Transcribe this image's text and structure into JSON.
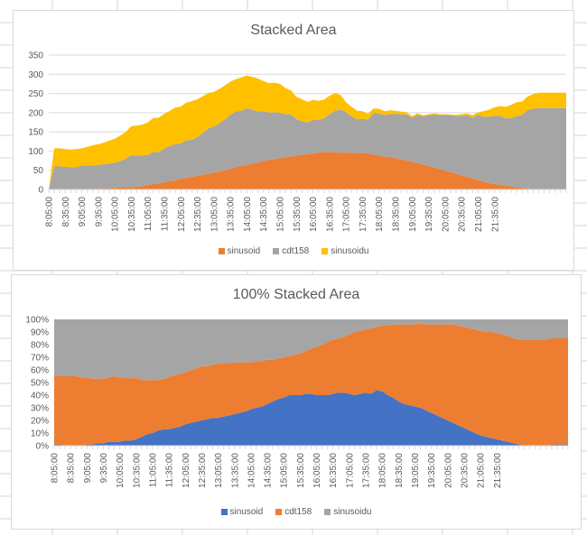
{
  "chart_data": [
    {
      "type": "area",
      "stacking": "normal",
      "title": "Stacked Area",
      "xlabel": "",
      "ylabel": "",
      "ylim": [
        0,
        350
      ],
      "yticks": [
        "0",
        "50",
        "100",
        "150",
        "200",
        "250",
        "300",
        "350"
      ],
      "grid": true,
      "legend": "bottom",
      "x_tick_labels": [
        "8:05:00",
        "8:35:00",
        "9:05:00",
        "9:35:00",
        "10:05:00",
        "10:35:00",
        "11:05:00",
        "11:35:00",
        "12:05:00",
        "12:35:00",
        "13:05:00",
        "13:35:00",
        "14:05:00",
        "14:35:00",
        "15:05:00",
        "15:35:00",
        "16:05:00",
        "16:35:00",
        "17:05:00",
        "17:35:00",
        "18:05:00",
        "18:35:00",
        "19:05:00",
        "19:35:00",
        "20:05:00",
        "20:35:00",
        "21:05:00",
        "21:35:00"
      ],
      "x_step_minutes": 10,
      "series": [
        {
          "name": "sinusoid",
          "color": "#ED7D31",
          "values": [
            0,
            0,
            0,
            0,
            0,
            0,
            0,
            0,
            0,
            1,
            2,
            3,
            4,
            5,
            6,
            6,
            7,
            9,
            12,
            14,
            16,
            19,
            22,
            24,
            28,
            30,
            33,
            36,
            38,
            41,
            44,
            47,
            50,
            54,
            58,
            62,
            64,
            67,
            70,
            74,
            77,
            79,
            82,
            84,
            86,
            88,
            90,
            92,
            94,
            96,
            97,
            98,
            97,
            96,
            96,
            96,
            95,
            95,
            94,
            91,
            88,
            86,
            84,
            82,
            78,
            75,
            72,
            69,
            65,
            61,
            57,
            53,
            49,
            45,
            41,
            37,
            33,
            29,
            25,
            21,
            17,
            14,
            12,
            10,
            8,
            6,
            4,
            2,
            0,
            0,
            0,
            0,
            0,
            0,
            0,
            0,
            0
          ]
        },
        {
          "name": "cdt158",
          "color": "#A5A5A5",
          "values": [
            0,
            60,
            60,
            59,
            58,
            58,
            62,
            63,
            63,
            63,
            64,
            64,
            66,
            69,
            74,
            83,
            81,
            80,
            78,
            84,
            81,
            88,
            91,
            94,
            92,
            98,
            97,
            101,
            109,
            118,
            120,
            125,
            133,
            141,
            145,
            143,
            148,
            140,
            134,
            130,
            123,
            122,
            118,
            112,
            110,
            95,
            88,
            82,
            87,
            85,
            88,
            98,
            108,
            112,
            105,
            94,
            88,
            89,
            88,
            108,
            110,
            108,
            112,
            115,
            118,
            120,
            115,
            125,
            125,
            132,
            138,
            141,
            145,
            148,
            150,
            155,
            160,
            158,
            170,
            168,
            173,
            178,
            180,
            175,
            178,
            185,
            190,
            205,
            210,
            212,
            212,
            212,
            212,
            212,
            212
          ]
        },
        {
          "name": "sinusoidu",
          "color": "#FFC000",
          "values": [
            0,
            47,
            47,
            46,
            46,
            47,
            45,
            48,
            52,
            54,
            56,
            60,
            62,
            66,
            70,
            76,
            78,
            80,
            85,
            88,
            90,
            90,
            92,
            95,
            96,
            98,
            100,
            98,
            96,
            92,
            90,
            90,
            88,
            86,
            84,
            87,
            85,
            86,
            85,
            78,
            77,
            77,
            75,
            68,
            62,
            58,
            57,
            54,
            52,
            50,
            49,
            48,
            46,
            38,
            26,
            25,
            22,
            20,
            15,
            12,
            12,
            10,
            10,
            8,
            7,
            6,
            4,
            4,
            3,
            3,
            3,
            2,
            2,
            2,
            3,
            4,
            5,
            6,
            6,
            15,
            18,
            22,
            25,
            30,
            34,
            36,
            35,
            35,
            38,
            40,
            40,
            40,
            40,
            40,
            40
          ]
        }
      ]
    },
    {
      "type": "area",
      "stacking": "percent",
      "title": "100% Stacked Area",
      "xlabel": "",
      "ylabel": "",
      "ylim": [
        0,
        100
      ],
      "yticks": [
        "0%",
        "10%",
        "20%",
        "30%",
        "40%",
        "50%",
        "60%",
        "70%",
        "80%",
        "90%",
        "100%"
      ],
      "grid": false,
      "legend": "bottom",
      "x_tick_labels": [
        "8:05:00",
        "8:35:00",
        "9:05:00",
        "9:35:00",
        "10:05:00",
        "10:35:00",
        "11:05:00",
        "11:35:00",
        "12:05:00",
        "12:35:00",
        "13:05:00",
        "13:35:00",
        "14:05:00",
        "14:35:00",
        "15:05:00",
        "15:35:00",
        "16:05:00",
        "16:35:00",
        "17:05:00",
        "17:35:00",
        "18:05:00",
        "18:35:00",
        "19:05:00",
        "19:35:00",
        "20:05:00",
        "20:35:00",
        "21:05:00",
        "21:35:00"
      ],
      "x_step_minutes": 10,
      "series": [
        {
          "name": "sinusoid",
          "color": "#4472C4",
          "percent_values": [
            1,
            1,
            0,
            0,
            0,
            0,
            1,
            1,
            2,
            2,
            3,
            3,
            3,
            4,
            4,
            5,
            7,
            9,
            10,
            12,
            13,
            13,
            14,
            15,
            17,
            18,
            19,
            20,
            21,
            22,
            22,
            23,
            24,
            25,
            26,
            27,
            29,
            30,
            31,
            33,
            35,
            37,
            38,
            40,
            40,
            40,
            41,
            41,
            40,
            40,
            40,
            41,
            42,
            42,
            41,
            40,
            41,
            42,
            41,
            44,
            43,
            40,
            38,
            35,
            33,
            32,
            31,
            30,
            28,
            26,
            24,
            22,
            20,
            18,
            16,
            14,
            12,
            10,
            8,
            7,
            6,
            5,
            4,
            3,
            2,
            1,
            0,
            0,
            0,
            0,
            0,
            1,
            1,
            1,
            1
          ]
        },
        {
          "name": "cdt158",
          "color": "#ED7D31",
          "percent_values": [
            54,
            54,
            55,
            55,
            55,
            54,
            53,
            52,
            51,
            51,
            51,
            52,
            51,
            50,
            49,
            49,
            45,
            43,
            42,
            40,
            40,
            41,
            42,
            42,
            41,
            42,
            42,
            43,
            42,
            42,
            43,
            42,
            41,
            41,
            40,
            39,
            37,
            37,
            36,
            35,
            33,
            32,
            32,
            31,
            32,
            33,
            34,
            36,
            38,
            40,
            42,
            43,
            43,
            44,
            47,
            50,
            50,
            50,
            52,
            50,
            52,
            55,
            58,
            61,
            63,
            64,
            65,
            67,
            68,
            70,
            72,
            74,
            76,
            78,
            79,
            80,
            81,
            82,
            83,
            83,
            84,
            84,
            84,
            84,
            83,
            83,
            84,
            84,
            84,
            84,
            84,
            84,
            84,
            84,
            84
          ]
        },
        {
          "name": "sinusoidu",
          "color": "#A5A5A5",
          "percent_values": [
            45,
            45,
            45,
            45,
            45,
            46,
            46,
            47,
            47,
            47,
            46,
            45,
            46,
            46,
            47,
            46,
            48,
            48,
            48,
            48,
            47,
            46,
            44,
            43,
            42,
            40,
            39,
            37,
            37,
            36,
            35,
            35,
            35,
            34,
            34,
            34,
            34,
            33,
            33,
            32,
            32,
            31,
            30,
            29,
            28,
            27,
            25,
            23,
            22,
            20,
            18,
            16,
            15,
            14,
            12,
            10,
            9,
            8,
            7,
            6,
            5,
            5,
            4,
            4,
            4,
            4,
            4,
            3,
            4,
            4,
            4,
            4,
            4,
            4,
            5,
            6,
            7,
            8,
            9,
            10,
            10,
            11,
            12,
            13,
            15,
            16,
            16,
            16,
            16,
            16,
            16,
            15,
            15,
            15,
            15
          ]
        }
      ]
    }
  ]
}
